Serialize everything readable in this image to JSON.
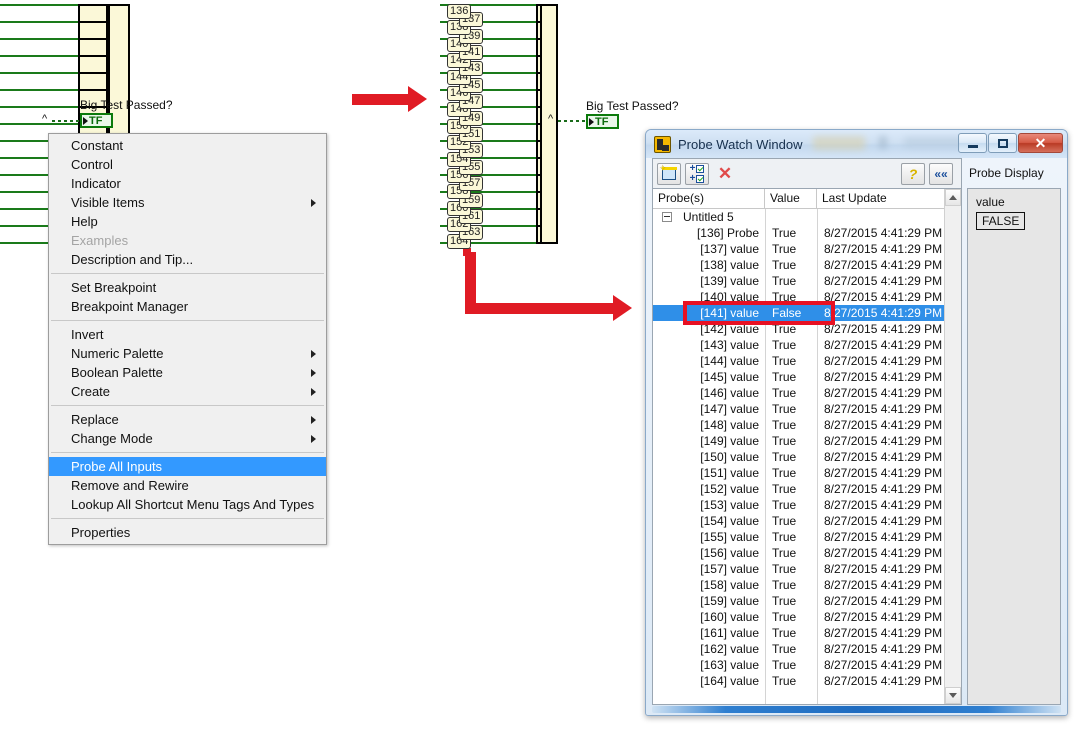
{
  "diagram": {
    "left": {
      "label": "Big Test Passed?",
      "constant_value": "TF",
      "tunnel_mark": "^"
    },
    "middle": {
      "label": "Big Test Passed?",
      "constant_value": "TF",
      "tunnel_mark": "^",
      "probe_tags": [
        "136",
        "137",
        "138",
        "139",
        "140",
        "141",
        "142",
        "143",
        "144",
        "145",
        "146",
        "147",
        "148",
        "149",
        "150",
        "151",
        "152",
        "153",
        "154",
        "155",
        "156",
        "157",
        "158",
        "159",
        "160",
        "161",
        "162",
        "163",
        "164"
      ]
    }
  },
  "context_menu": {
    "items": [
      {
        "label": "Constant",
        "submenu": false,
        "disabled": false,
        "selected": false
      },
      {
        "label": "Control",
        "submenu": false,
        "disabled": false,
        "selected": false
      },
      {
        "label": "Indicator",
        "submenu": false,
        "disabled": false,
        "selected": false
      },
      {
        "label": "Visible Items",
        "submenu": true,
        "disabled": false,
        "selected": false
      },
      {
        "label": "Help",
        "submenu": false,
        "disabled": false,
        "selected": false
      },
      {
        "label": "Examples",
        "submenu": false,
        "disabled": true,
        "selected": false
      },
      {
        "label": "Description and Tip...",
        "submenu": false,
        "disabled": false,
        "selected": false
      },
      {
        "separator": true
      },
      {
        "label": "Set Breakpoint",
        "submenu": false,
        "disabled": false,
        "selected": false
      },
      {
        "label": "Breakpoint Manager",
        "submenu": false,
        "disabled": false,
        "selected": false
      },
      {
        "separator": true
      },
      {
        "label": "Invert",
        "submenu": false,
        "disabled": false,
        "selected": false
      },
      {
        "label": "Numeric Palette",
        "submenu": true,
        "disabled": false,
        "selected": false
      },
      {
        "label": "Boolean Palette",
        "submenu": true,
        "disabled": false,
        "selected": false
      },
      {
        "label": "Create",
        "submenu": true,
        "disabled": false,
        "selected": false
      },
      {
        "separator": true
      },
      {
        "label": "Replace",
        "submenu": true,
        "disabled": false,
        "selected": false
      },
      {
        "label": "Change Mode",
        "submenu": true,
        "disabled": false,
        "selected": false
      },
      {
        "separator": true
      },
      {
        "label": "Probe All Inputs",
        "submenu": false,
        "disabled": false,
        "selected": true
      },
      {
        "label": "Remove and Rewire",
        "submenu": false,
        "disabled": false,
        "selected": false
      },
      {
        "label": "Lookup All Shortcut Menu Tags And Types",
        "submenu": false,
        "disabled": false,
        "selected": false
      },
      {
        "separator": true
      },
      {
        "label": "Properties",
        "submenu": false,
        "disabled": false,
        "selected": false
      }
    ]
  },
  "probe_watch_window": {
    "title": "Probe Watch Window",
    "window_buttons": {
      "minimize": "minimize-button",
      "maximize": "maximize-button",
      "close": "✕"
    },
    "toolbar": {
      "new_probe": "new-probe-button",
      "add_all": "add-all-probes-button",
      "delete": "✕",
      "help": "?",
      "collapse": "««"
    },
    "columns": [
      "Probe(s)",
      "Value",
      "Last Update"
    ],
    "group": {
      "name": "Untitled 5",
      "expanded": true
    },
    "rows": [
      {
        "probe": "[136] Probe",
        "value": "True",
        "update": "8/27/2015 4:41:29 PM",
        "selected": false
      },
      {
        "probe": "[137] value",
        "value": "True",
        "update": "8/27/2015 4:41:29 PM",
        "selected": false
      },
      {
        "probe": "[138] value",
        "value": "True",
        "update": "8/27/2015 4:41:29 PM",
        "selected": false
      },
      {
        "probe": "[139] value",
        "value": "True",
        "update": "8/27/2015 4:41:29 PM",
        "selected": false
      },
      {
        "probe": "[140] value",
        "value": "True",
        "update": "8/27/2015 4:41:29 PM",
        "selected": false
      },
      {
        "probe": "[141] value",
        "value": "False",
        "update": "8/27/2015 4:41:29 PM",
        "selected": true
      },
      {
        "probe": "[142] value",
        "value": "True",
        "update": "8/27/2015 4:41:29 PM",
        "selected": false
      },
      {
        "probe": "[143] value",
        "value": "True",
        "update": "8/27/2015 4:41:29 PM",
        "selected": false
      },
      {
        "probe": "[144] value",
        "value": "True",
        "update": "8/27/2015 4:41:29 PM",
        "selected": false
      },
      {
        "probe": "[145] value",
        "value": "True",
        "update": "8/27/2015 4:41:29 PM",
        "selected": false
      },
      {
        "probe": "[146] value",
        "value": "True",
        "update": "8/27/2015 4:41:29 PM",
        "selected": false
      },
      {
        "probe": "[147] value",
        "value": "True",
        "update": "8/27/2015 4:41:29 PM",
        "selected": false
      },
      {
        "probe": "[148] value",
        "value": "True",
        "update": "8/27/2015 4:41:29 PM",
        "selected": false
      },
      {
        "probe": "[149] value",
        "value": "True",
        "update": "8/27/2015 4:41:29 PM",
        "selected": false
      },
      {
        "probe": "[150] value",
        "value": "True",
        "update": "8/27/2015 4:41:29 PM",
        "selected": false
      },
      {
        "probe": "[151] value",
        "value": "True",
        "update": "8/27/2015 4:41:29 PM",
        "selected": false
      },
      {
        "probe": "[152] value",
        "value": "True",
        "update": "8/27/2015 4:41:29 PM",
        "selected": false
      },
      {
        "probe": "[153] value",
        "value": "True",
        "update": "8/27/2015 4:41:29 PM",
        "selected": false
      },
      {
        "probe": "[154] value",
        "value": "True",
        "update": "8/27/2015 4:41:29 PM",
        "selected": false
      },
      {
        "probe": "[155] value",
        "value": "True",
        "update": "8/27/2015 4:41:29 PM",
        "selected": false
      },
      {
        "probe": "[156] value",
        "value": "True",
        "update": "8/27/2015 4:41:29 PM",
        "selected": false
      },
      {
        "probe": "[157] value",
        "value": "True",
        "update": "8/27/2015 4:41:29 PM",
        "selected": false
      },
      {
        "probe": "[158] value",
        "value": "True",
        "update": "8/27/2015 4:41:29 PM",
        "selected": false
      },
      {
        "probe": "[159] value",
        "value": "True",
        "update": "8/27/2015 4:41:29 PM",
        "selected": false
      },
      {
        "probe": "[160] value",
        "value": "True",
        "update": "8/27/2015 4:41:29 PM",
        "selected": false
      },
      {
        "probe": "[161] value",
        "value": "True",
        "update": "8/27/2015 4:41:29 PM",
        "selected": false
      },
      {
        "probe": "[162] value",
        "value": "True",
        "update": "8/27/2015 4:41:29 PM",
        "selected": false
      },
      {
        "probe": "[163] value",
        "value": "True",
        "update": "8/27/2015 4:41:29 PM",
        "selected": false
      },
      {
        "probe": "[164] value",
        "value": "True",
        "update": "8/27/2015 4:41:29 PM",
        "selected": false
      }
    ],
    "probe_display": {
      "title": "Probe Display",
      "label": "value",
      "value": "FALSE"
    }
  },
  "colors": {
    "annotation_red": "#e81123",
    "selection_blue": "#2f8fe8",
    "menu_highlight": "#3399ff",
    "wire_green": "#1a7a1a"
  }
}
